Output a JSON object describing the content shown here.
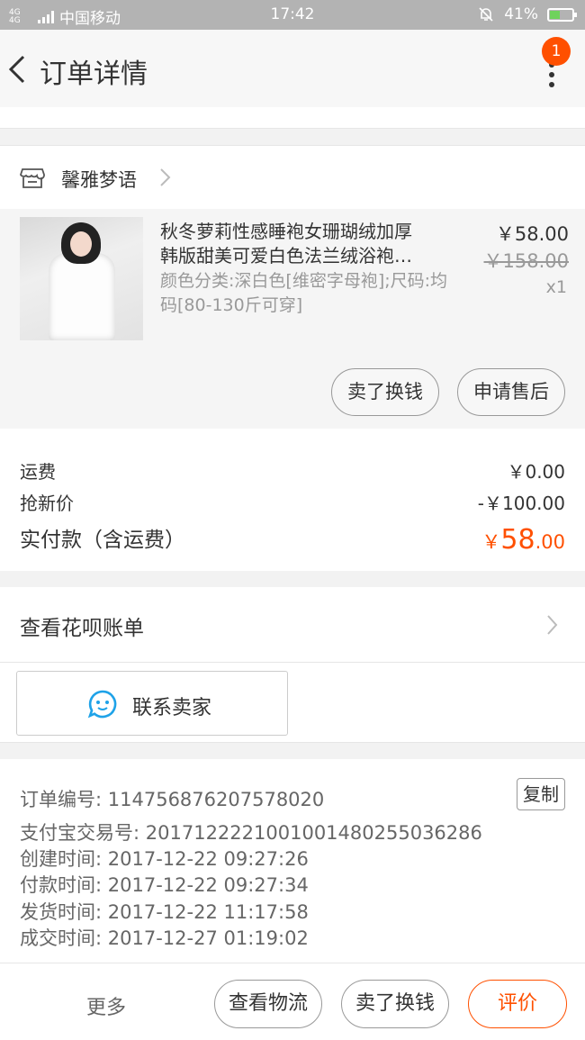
{
  "status_bar": {
    "network": "4G 4G",
    "carrier": "中国移动",
    "time": "17:42",
    "battery": "41%",
    "battery_level": 0.41,
    "icons": [
      "signal-icon",
      "mute-bell-icon",
      "battery-icon"
    ]
  },
  "header": {
    "title": "订单详情",
    "badge_count": "1",
    "icons": [
      "back-arrow-icon",
      "more-vertical-icon"
    ]
  },
  "shop": {
    "name": "馨雅梦语",
    "icons": [
      "shop-icon",
      "chevron-right-icon"
    ]
  },
  "product": {
    "title_line1": "秋冬萝莉性感睡袍女珊瑚绒加厚",
    "title_line2": "韩版甜美可爱白色法兰绒浴袍…",
    "sku": "颜色分类:深白色[维密字母袍];尺码:均码[80-130斤可穿]",
    "price": "￥58.00",
    "original_price": "￥158.00",
    "quantity": "x1",
    "sell_button": "卖了换钱",
    "after_sale_button": "申请售后"
  },
  "summary": {
    "shipping_label": "运费",
    "shipping_value": "￥0.00",
    "discount_label": "抢新价",
    "discount_value": "-￥100.00",
    "total_label": "实付款（含运费）",
    "total_currency": "￥",
    "total_int": "58",
    "total_dec": ".00",
    "accent_color": "#ff5000"
  },
  "huabei": {
    "label": "查看花呗账单"
  },
  "contact": {
    "label": "联系卖家",
    "icon": "chat-bubble-icon",
    "icon_color": "#1ea2e8"
  },
  "order_info": {
    "rows": [
      {
        "label": "订单编号:",
        "value": "114756876207578020"
      },
      {
        "label": "支付宝交易号:",
        "value": "2017122221001001480255036286"
      },
      {
        "label": "创建时间:",
        "value": "2017-12-22 09:27:26"
      },
      {
        "label": "付款时间:",
        "value": "2017-12-22 09:27:34"
      },
      {
        "label": "发货时间:",
        "value": "2017-12-22 11:17:58"
      },
      {
        "label": "成交时间:",
        "value": "2017-12-27 01:19:02"
      }
    ],
    "copy_button": "复制"
  },
  "bottom_bar": {
    "more": "更多",
    "logistics": "查看物流",
    "sell": "卖了换钱",
    "review": "评价"
  }
}
